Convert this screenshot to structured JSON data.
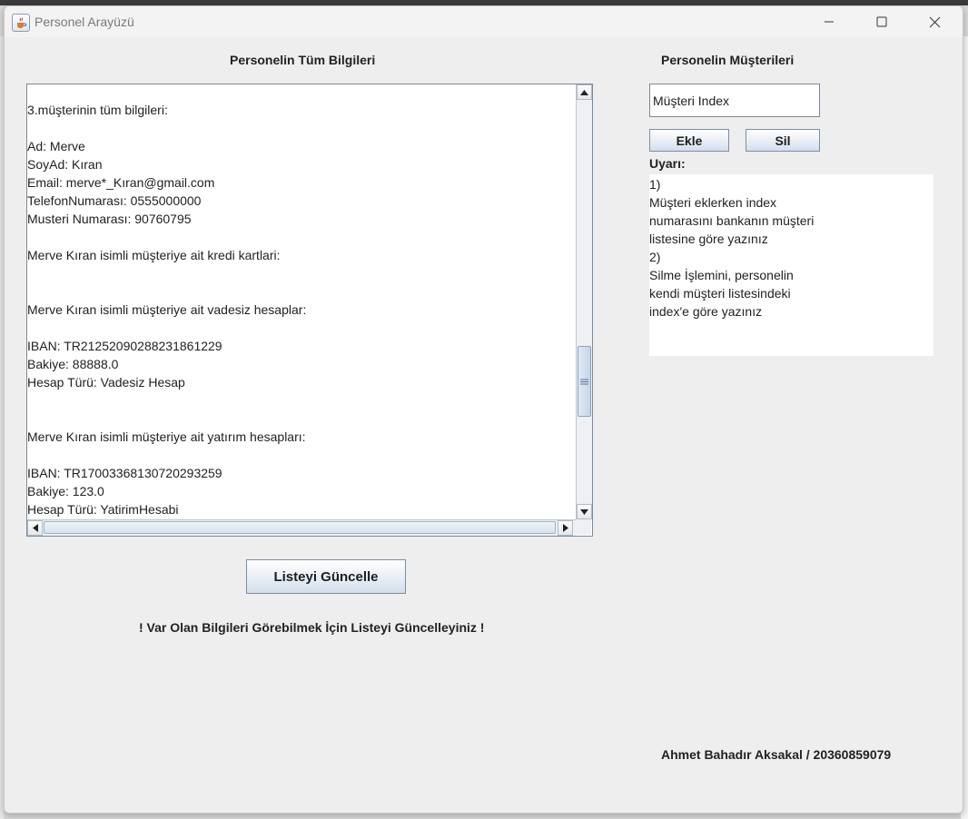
{
  "window": {
    "title": "Personel Arayüzü"
  },
  "left_panel": {
    "heading": "Personelin Tüm Bilgileri",
    "info_lines": [
      "3.müşterinin tüm bilgileri:",
      "",
      "Ad: Merve",
      "SoyAd: Kıran",
      "Email: merve*_Kıran@gmail.com",
      "TelefonNumarası: 0555000000",
      "Musteri Numarası: 90760795",
      "",
      "Merve Kıran isimli müşteriye ait kredi kartlari:",
      "",
      "",
      "Merve Kıran isimli müşteriye ait vadesiz hesaplar:",
      "",
      "IBAN: TR21252090288231861229",
      "Bakiye: 88888.0",
      "Hesap Türü: Vadesiz Hesap",
      "",
      "",
      "Merve Kıran isimli müşteriye ait yatırım hesapları:",
      "",
      "IBAN: TR17003368130720293259",
      "Bakiye: 123.0",
      "Hesap Türü: YatirimHesabi"
    ],
    "update_button": "Listeyi Güncelle",
    "notice": "! Var Olan Bilgileri Görebilmek İçin Listeyi Güncelleyiniz !"
  },
  "right_panel": {
    "heading": "Personelin Müşterileri",
    "index_input_value": "Müşteri Index",
    "add_button": "Ekle",
    "delete_button": "Sil",
    "warning_label": "Uyarı:",
    "warning_lines": [
      "1)",
      "Müşteri eklerken index",
      "numarasını bankanın müşteri",
      "listesine göre yazınız",
      "2)",
      "Silme İşlemini, personelin",
      "kendi müşteri listesindeki",
      "index'e göre yazınız"
    ]
  },
  "footer": {
    "author": "Ahmet Bahadır Aksakal / 20360859079"
  },
  "icons": {
    "app": "java-cup-icon",
    "minimize": "minimize-icon",
    "maximize": "maximize-icon",
    "close": "close-icon"
  }
}
